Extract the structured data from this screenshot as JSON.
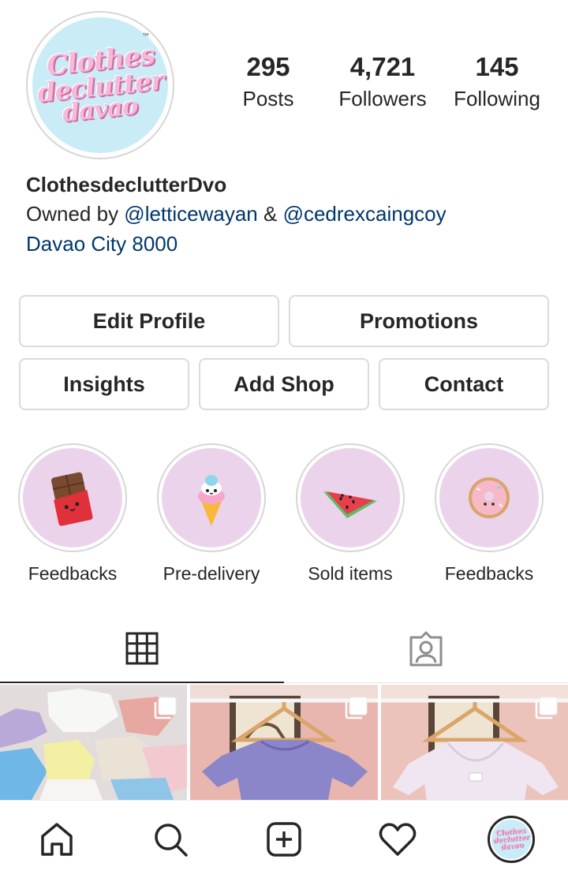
{
  "profile": {
    "avatar_logo_lines": [
      "Clothes",
      "declutter",
      "davao"
    ],
    "avatar_tm": "™",
    "stats": [
      {
        "value": "295",
        "label": "Posts"
      },
      {
        "value": "4,721",
        "label": "Followers"
      },
      {
        "value": "145",
        "label": "Following"
      }
    ],
    "name": "ClothesdeclutterDvo",
    "bio_prefix": "Owned by ",
    "mention_1": "@letticewayan",
    "bio_joiner": " & ",
    "mention_2": "@cedrexcaingcoy",
    "location": "Davao City 8000"
  },
  "buttons": {
    "edit_profile": "Edit Profile",
    "promotions": "Promotions",
    "insights": "Insights",
    "add_shop": "Add Shop",
    "contact": "Contact"
  },
  "highlights": [
    {
      "label": "Feedbacks",
      "icon": "chocolate-bar-icon"
    },
    {
      "label": "Pre-delivery",
      "icon": "ice-cream-icon"
    },
    {
      "label": "Sold items",
      "icon": "watermelon-icon"
    },
    {
      "label": "Feedbacks",
      "icon": "donut-icon"
    }
  ],
  "tabs": [
    {
      "name": "grid",
      "icon": "grid-icon",
      "active": true
    },
    {
      "name": "tagged",
      "icon": "tagged-person-icon",
      "active": false
    }
  ],
  "photos": [
    {
      "icon": "multiple-photos-icon",
      "subject": "folded tops"
    },
    {
      "icon": "multiple-photos-icon",
      "subject": "lavender knit top on hanger"
    },
    {
      "icon": "multiple-photos-icon",
      "subject": "white top on hanger"
    }
  ],
  "bottom_nav": [
    "home-icon",
    "search-icon",
    "new-post-icon",
    "activity-heart-icon",
    "profile-avatar"
  ],
  "colors": {
    "link": "#00376b",
    "text": "#262626",
    "border": "#dbdbdb",
    "highlight_bg": "#ecd3ec",
    "avatar_bg": "#c9ecf6",
    "logo_pink": "#f6b9d8"
  }
}
